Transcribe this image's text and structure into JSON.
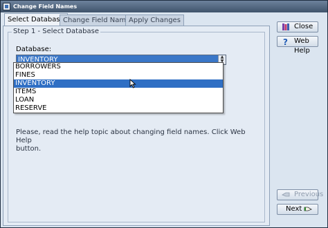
{
  "window": {
    "title": "Change Field Names"
  },
  "tabs": [
    {
      "label": "Select Database"
    },
    {
      "label": "Change Field Names"
    },
    {
      "label": "Apply Changes"
    }
  ],
  "step": {
    "legend": "Step 1 - Select Database",
    "database_label": "Database:",
    "selected_value": "INVENTORY",
    "options": [
      "BORROWERS",
      "FINES",
      "INVENTORY",
      "ITEMS",
      "LOAN",
      "RESERVE"
    ],
    "help_text_line1": "Please, read the help topic about changing field names. Click Web Help",
    "help_text_line2": "button."
  },
  "buttons": {
    "close": "Close",
    "web_help": "Web Help",
    "previous": "Previous",
    "next": "Next"
  },
  "colors": {
    "selection": "#2f6fc4",
    "panel": "#e4ebf4"
  }
}
